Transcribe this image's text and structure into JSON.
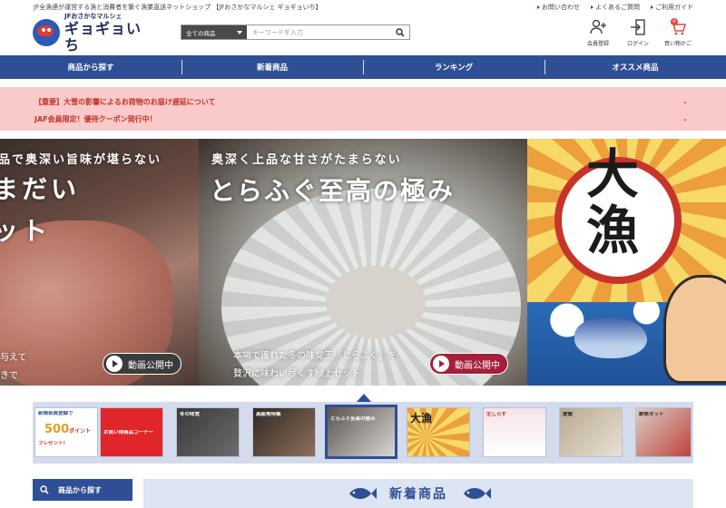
{
  "header": {
    "tagline": "JF全漁連が運営する漁と消費者を繋ぐ漁業直送ネットショップ 【JFおさかなマルシェ ギョギョいち】",
    "top_links": [
      {
        "label": "お問い合わせ"
      },
      {
        "label": "よくあるご質問"
      },
      {
        "label": "ご利用ガイド"
      }
    ],
    "logo": {
      "sub": "JFおさかなマルシェ",
      "main": "ギョギョいち"
    },
    "search": {
      "category": "全ての商品",
      "placeholder": "キーワードを入力"
    },
    "icons": [
      {
        "label": "会員登録",
        "icon": "user-plus-icon"
      },
      {
        "label": "ログイン",
        "icon": "login-icon"
      },
      {
        "label": "買い物かご",
        "icon": "cart-icon",
        "badge": "0"
      }
    ]
  },
  "nav": {
    "items": [
      {
        "label": "商品から探す"
      },
      {
        "label": "新着商品"
      },
      {
        "label": "ランキング"
      },
      {
        "label": "オススメ商品"
      }
    ]
  },
  "notices": [
    {
      "text": "【重要】大雪の影響によるお荷物のお届け遅延について"
    },
    {
      "text": "JAF会員限定！優待クーポン発行中！"
    }
  ],
  "hero": {
    "slides": [
      {
        "subtitle": "品で奥深い旨味が堪らない",
        "title1": "まだい",
        "title2": "ット",
        "desc1": "与えて",
        "desc2": "きで",
        "button": "動画公開中"
      },
      {
        "subtitle": "奥深く上品な甘さがたまらない",
        "title": "とらふぐ至高の極み",
        "desc1": "本場で獲れた冬の味覚王「とらふぐ」を",
        "desc2": "贅沢に味わい尽くす極上セット",
        "button": "動画公開中"
      },
      {
        "title": "大漁"
      }
    ]
  },
  "thumbnails": [
    {
      "caption": "新規会員登録で",
      "big_value": "500",
      "big_unit": "ポイント",
      "line": "プレゼント!"
    },
    {
      "caption": "お買い得商品コーナー"
    },
    {
      "caption": "冬の味覚"
    },
    {
      "caption": "高級魚特集"
    },
    {
      "caption": "とらふぐ至高の極み"
    },
    {
      "caption": "大漁"
    },
    {
      "caption": "生しらす"
    },
    {
      "caption": "愛媛"
    },
    {
      "caption": "鮮魚セット"
    }
  ],
  "bottom": {
    "side_button": "商品から探す",
    "section_title": "新着商品"
  },
  "colors": {
    "primary": "#2e4f96",
    "notice_bg": "#fac9c9",
    "notice_text": "#c23326",
    "cart_accent": "#e8473a"
  }
}
